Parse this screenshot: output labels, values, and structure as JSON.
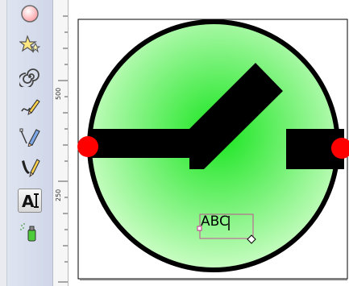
{
  "toolbox": {
    "tools": [
      {
        "name": "ellipse-tool",
        "icon": "ellipse-icon",
        "active": false
      },
      {
        "name": "star-tool",
        "icon": "star-icon",
        "active": false
      },
      {
        "name": "spiral-tool",
        "icon": "spiral-icon",
        "active": false
      },
      {
        "name": "pencil-tool",
        "icon": "pencil-icon",
        "active": false
      },
      {
        "name": "pen-tool",
        "icon": "pen-icon",
        "active": false
      },
      {
        "name": "calligraphy-tool",
        "icon": "calligraphy-icon",
        "active": false
      },
      {
        "name": "text-tool",
        "icon": "text-tool-icon",
        "active": true
      },
      {
        "name": "spray-tool",
        "icon": "spray-icon",
        "active": false
      }
    ]
  },
  "ruler": {
    "labels": [
      "500",
      "250"
    ]
  },
  "canvas": {
    "text_object": "ABC",
    "colors": {
      "fill_light": "#d9ffd2",
      "fill_dark": "#17e51e",
      "stroke": "#000000",
      "node_red": "#ff0000",
      "text_bbox": "#cc2b90"
    }
  }
}
